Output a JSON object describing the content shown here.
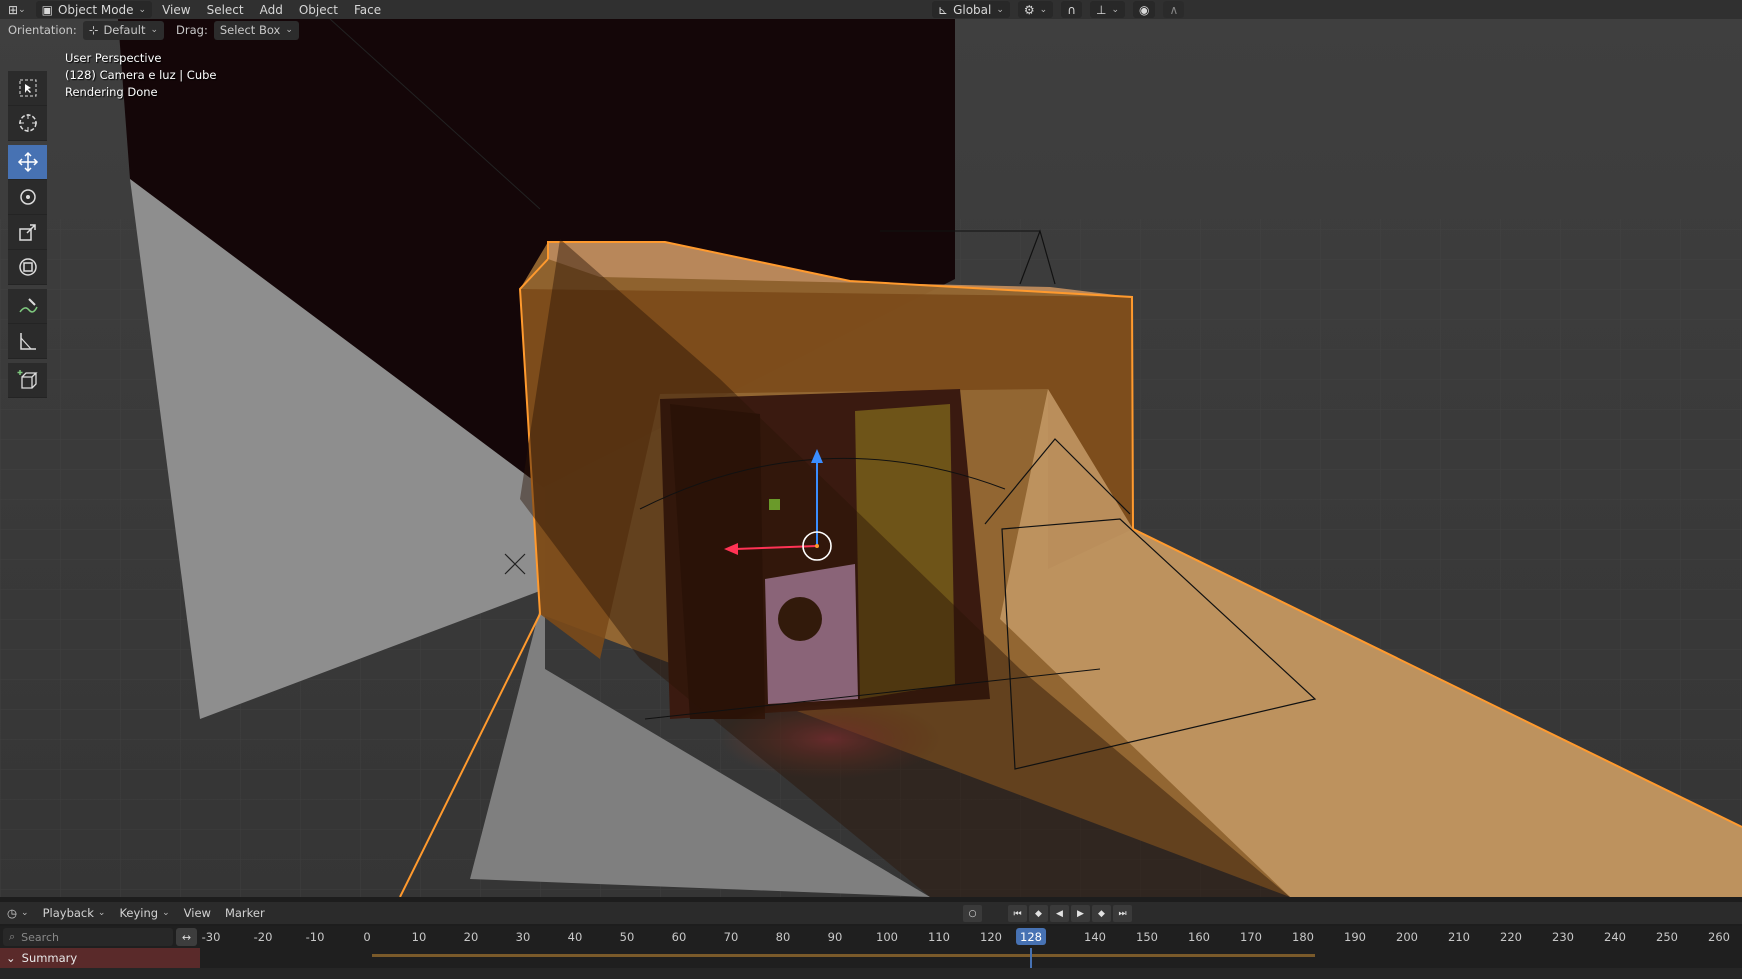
{
  "header": {
    "editor_icon": "view3d-icon",
    "mode": "Object Mode",
    "menus": [
      "View",
      "Select",
      "Add",
      "Object",
      "Face"
    ],
    "transform_orientation": "Global",
    "transform_orientation_icon": "orientation-global-icon",
    "pivot_icon": "pivot-icon",
    "snap_icon": "magnet-icon",
    "proportional_icon": "proportional-edit-icon"
  },
  "tool_options": {
    "orientation_label": "Orientation:",
    "orientation_value": "Default",
    "drag_label": "Drag:",
    "drag_value": "Select Box"
  },
  "viewport": {
    "overlay_lines": [
      "User Perspective",
      "(128) Camera e luz | Cube",
      "Rendering Done"
    ]
  },
  "toolbar": {
    "tools": [
      "select-box-tool",
      "cursor-tool",
      "move-tool",
      "rotate-tool",
      "scale-tool",
      "transform-tool",
      "annotate-tool",
      "measure-tool",
      "add-cube-tool"
    ],
    "active": "move-tool"
  },
  "timeline": {
    "menus": [
      "Playback",
      "Keying",
      "View",
      "Marker"
    ],
    "search_placeholder": "Search",
    "ticks": [
      "-30",
      "-20",
      "-10",
      "0",
      "10",
      "20",
      "30",
      "40",
      "50",
      "60",
      "70",
      "80",
      "90",
      "100",
      "110",
      "120",
      "140",
      "150",
      "160",
      "170",
      "180",
      "190",
      "200",
      "210",
      "220",
      "230",
      "240",
      "250",
      "260"
    ],
    "current_frame": "128",
    "summary_label": "Summary"
  },
  "colors": {
    "accent": "#4772b3",
    "selection_outline": "#ff9a2e",
    "summary_bg": "#5a2a2a"
  }
}
